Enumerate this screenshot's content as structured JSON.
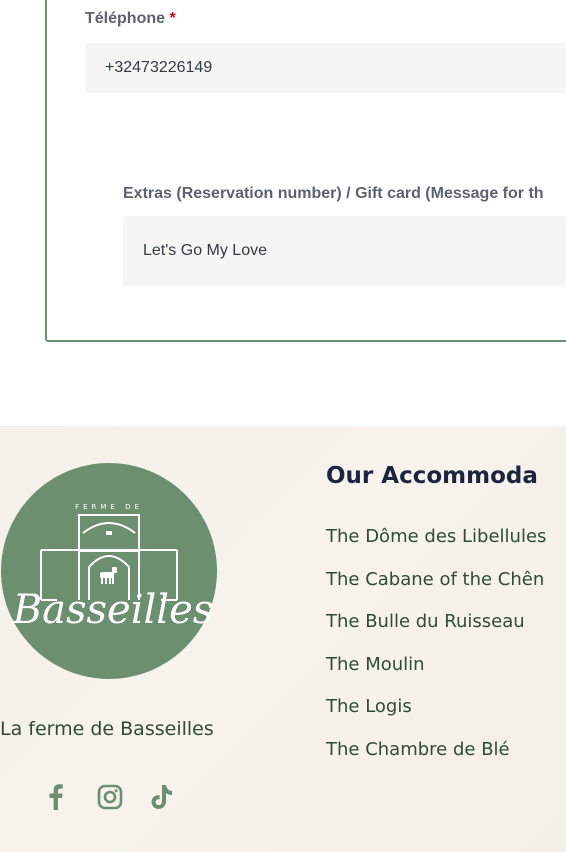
{
  "form": {
    "phone_label": "Téléphone",
    "required_mark": "*",
    "phone_value": "+32473226149",
    "extras_label": "Extras (Reservation number) / Gift card (Message for th",
    "extras_value": "Let's Go My Love"
  },
  "footer": {
    "logo": {
      "top_text": "FERME DE",
      "script_text": "Basseilles",
      "color": "#6b8f6f"
    },
    "brand_name": "La ferme de Basseilles",
    "social": [
      {
        "icon": "facebook-icon"
      },
      {
        "icon": "instagram-icon"
      },
      {
        "icon": "tiktok-icon"
      }
    ],
    "accommodations_title": "Our Accommoda",
    "accommodations": [
      "The Dôme des Libellules",
      "The Cabane of the Chên",
      "The Bulle du Ruisseau",
      "The Moulin",
      "The Logis",
      "The Chambre de Blé"
    ]
  },
  "colors": {
    "accent_green": "#6b8f6f",
    "required_red": "#d0021b",
    "title_navy": "#1b2540"
  }
}
